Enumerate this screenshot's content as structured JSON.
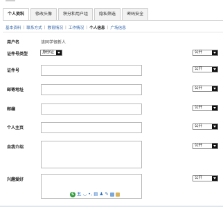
{
  "tabs": [
    {
      "label": "个人资料",
      "active": true
    },
    {
      "label": "修改头像",
      "active": false
    },
    {
      "label": "积分和用户组",
      "active": false
    },
    {
      "label": "隐私筛选",
      "active": false
    },
    {
      "label": "密码安全",
      "active": false
    }
  ],
  "subnav": [
    {
      "label": "基本资料",
      "active": false
    },
    {
      "label": "联系方式",
      "active": false
    },
    {
      "label": "教育情况",
      "active": false
    },
    {
      "label": "工作情况",
      "active": false
    },
    {
      "label": "个人信息",
      "active": true
    },
    {
      "label": "广场信息",
      "active": false
    }
  ],
  "subnav_separator": "|",
  "form": {
    "username": {
      "label": "用户名",
      "value": "该同学很新人"
    },
    "id_type": {
      "label": "证件号类型",
      "value": "身份证"
    },
    "id_number": {
      "label": "证件号",
      "value": ""
    },
    "address": {
      "label": "邮寄地址",
      "value": ""
    },
    "zipcode": {
      "label": "邮编",
      "value": ""
    },
    "homepage": {
      "label": "个人主页",
      "value": ""
    },
    "bio": {
      "label": "自我介绍",
      "value": ""
    },
    "interests": {
      "label": "兴趣爱好",
      "value": ""
    }
  },
  "privacy": {
    "id_type": "公开",
    "id_number": "公开",
    "address": "公开",
    "zipcode": "公开",
    "homepage": "公开",
    "bio": "公开",
    "interests": "公开"
  },
  "ime": {
    "logo": "S",
    "glyphs": "五 ◡ •, ▤ ♟ ✎"
  },
  "colors": {
    "link": "#3366aa",
    "ime_logo": "#2d9b3a",
    "ime_glyph": "#2a6fc0"
  }
}
